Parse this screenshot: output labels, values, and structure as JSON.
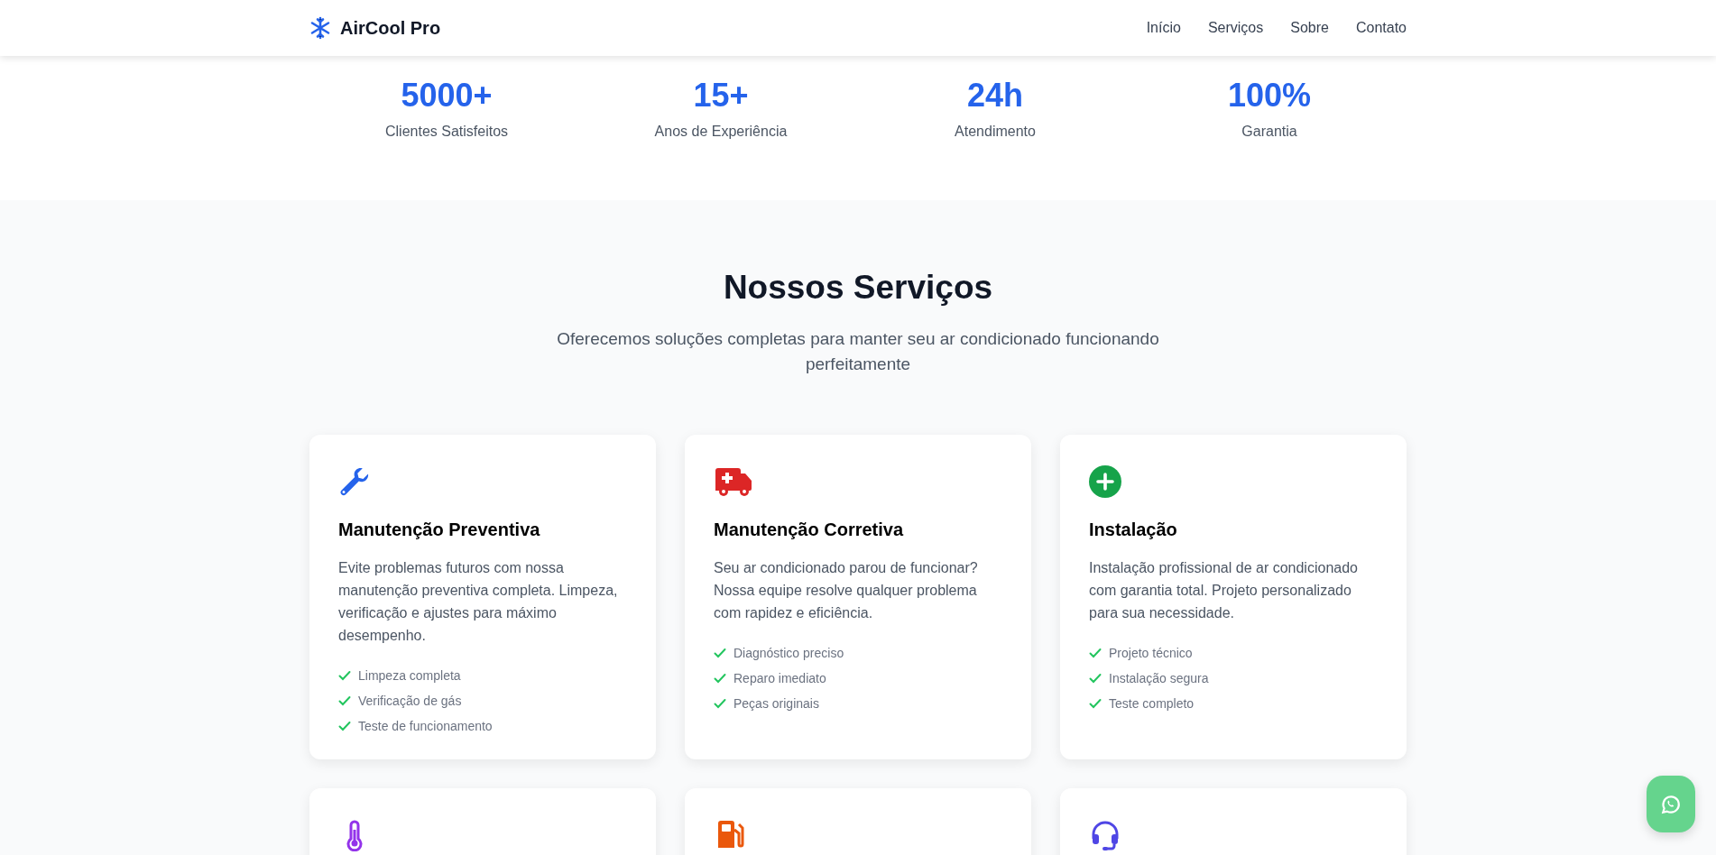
{
  "header": {
    "brand": "AirCool Pro",
    "nav": [
      {
        "label": "Início"
      },
      {
        "label": "Serviços"
      },
      {
        "label": "Sobre"
      },
      {
        "label": "Contato"
      }
    ]
  },
  "stats": [
    {
      "value": "5000+",
      "label": "Clientes Satisfeitos"
    },
    {
      "value": "15+",
      "label": "Anos de Experiência"
    },
    {
      "value": "24h",
      "label": "Atendimento"
    },
    {
      "value": "100%",
      "label": "Garantia"
    }
  ],
  "services": {
    "title": "Nossos Serviços",
    "subtitle": "Oferecemos soluções completas para manter seu ar condicionado funcionando perfeitamente",
    "cards": [
      {
        "kind": "wrench",
        "title": "Manutenção Preventiva",
        "description": "Evite problemas futuros com nossa manutenção preventiva completa. Limpeza, verificação e ajustes para máximo desempenho.",
        "features": [
          "Limpeza completa",
          "Verificação de gás",
          "Teste de funcionamento"
        ]
      },
      {
        "kind": "ambulance",
        "title": "Manutenção Corretiva",
        "description": "Seu ar condicionado parou de funcionar? Nossa equipe resolve qualquer problema com rapidez e eficiência.",
        "features": [
          "Diagnóstico preciso",
          "Reparo imediato",
          "Peças originais"
        ]
      },
      {
        "kind": "plus",
        "title": "Instalação",
        "description": "Instalação profissional de ar condicionado com garantia total. Projeto personalizado para sua necessidade.",
        "features": [
          "Projeto técnico",
          "Instalação segura",
          "Teste completo"
        ]
      },
      {
        "kind": "thermometer"
      },
      {
        "kind": "fuel"
      },
      {
        "kind": "headset"
      }
    ]
  }
}
